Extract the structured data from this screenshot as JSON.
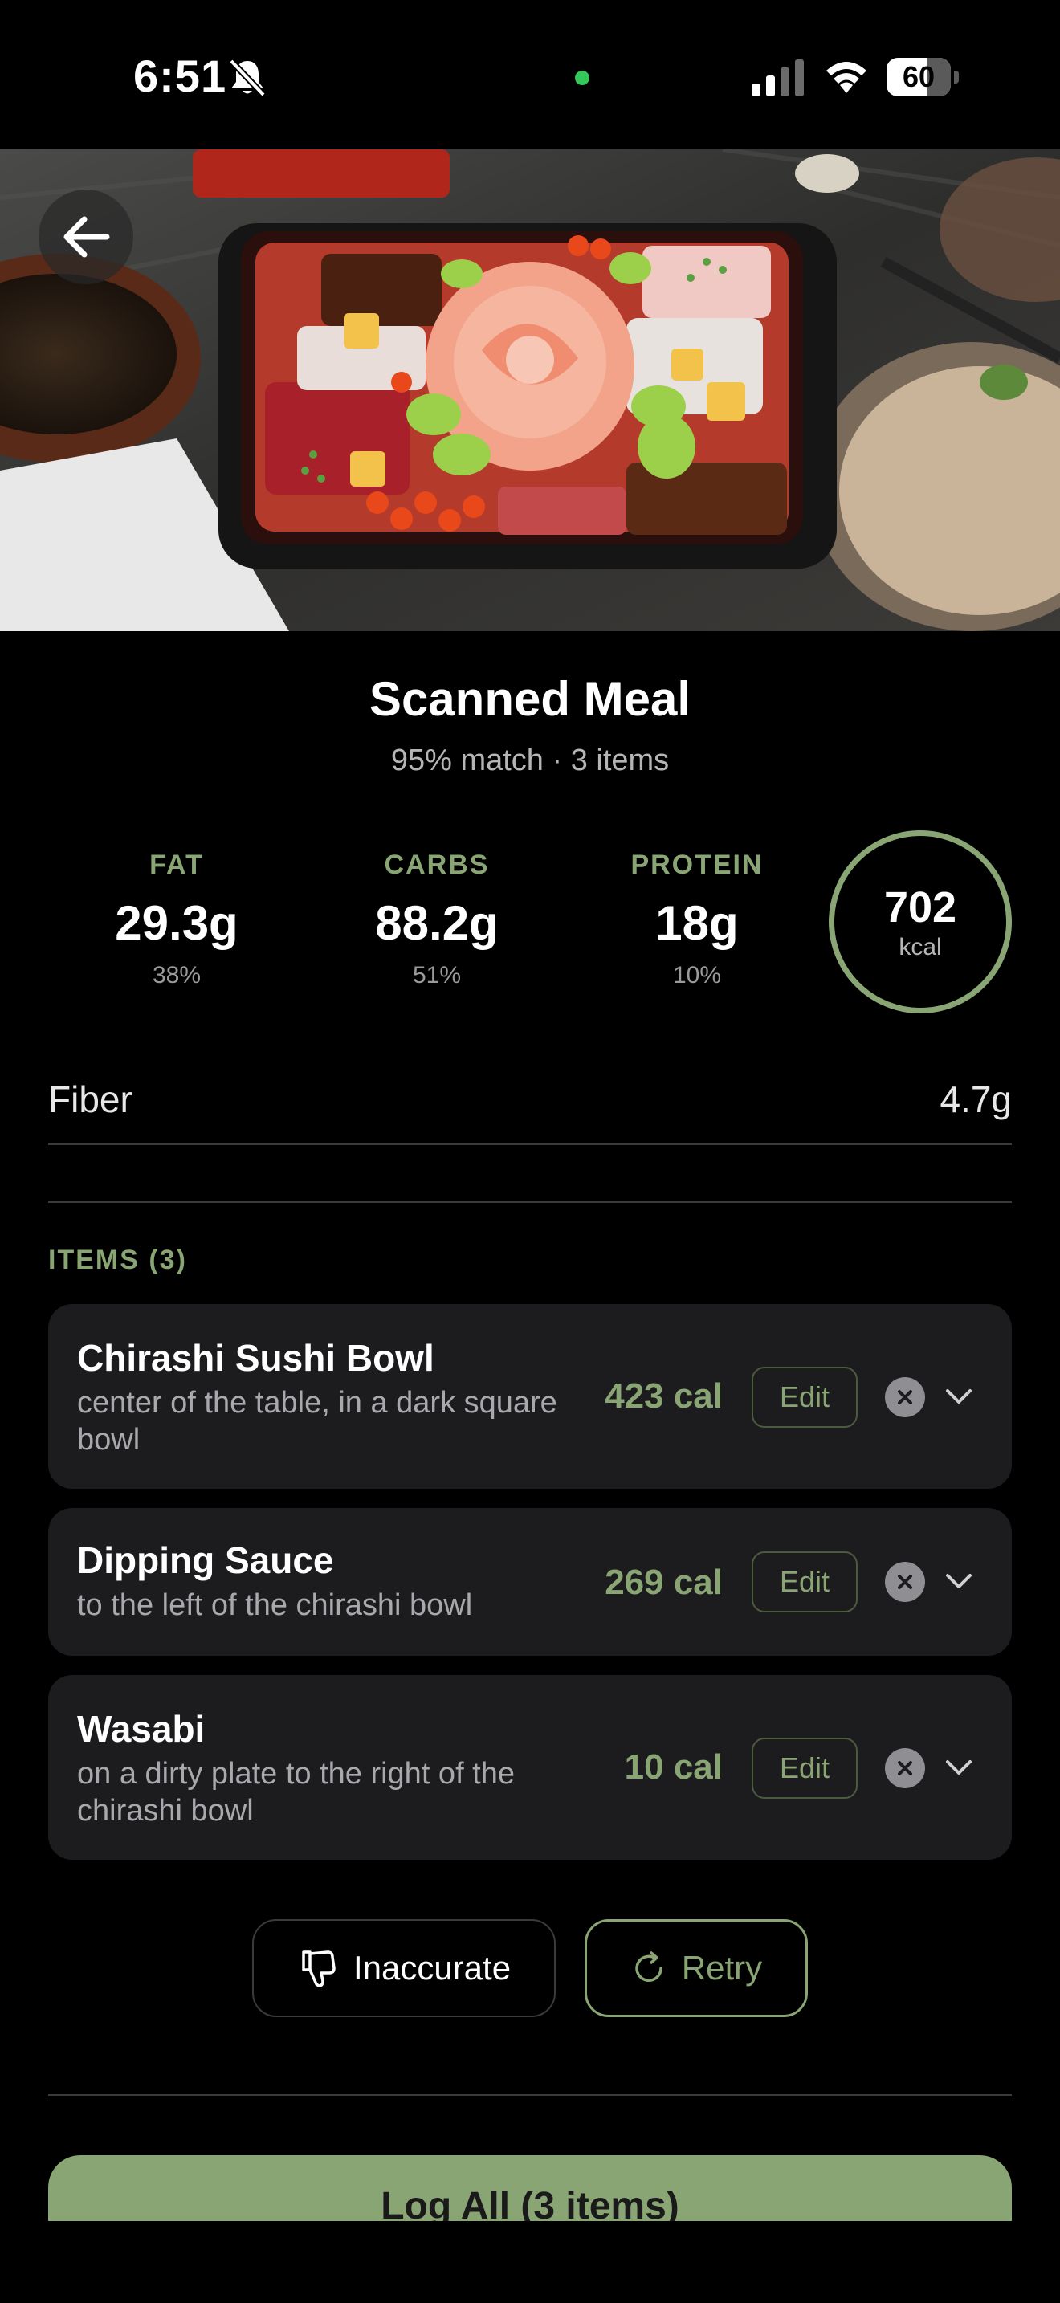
{
  "status_bar": {
    "time": "6:51",
    "battery": "60",
    "icons": [
      "bell-slash-icon",
      "signal-icon",
      "wifi-icon",
      "battery-icon"
    ]
  },
  "hero": {
    "back_icon": "arrow-left-icon"
  },
  "meal": {
    "title": "Scanned Meal",
    "subtitle": "95% match · 3 items"
  },
  "macros": [
    {
      "label": "FAT",
      "value": "29.3g",
      "percent": "38%"
    },
    {
      "label": "CARBS",
      "value": "88.2g",
      "percent": "51%"
    },
    {
      "label": "PROTEIN",
      "value": "18g",
      "percent": "10%"
    }
  ],
  "calories": {
    "value": "702",
    "unit": "kcal"
  },
  "fiber": {
    "label": "Fiber",
    "value": "4.7g"
  },
  "items_header": "ITEMS (3)",
  "items": [
    {
      "name": "Chirashi Sushi Bowl",
      "description": "center of the table, in a dark square bowl",
      "calories": "423 cal",
      "edit_label": "Edit"
    },
    {
      "name": "Dipping Sauce",
      "description": "to the left of the chirashi bowl",
      "calories": "269 cal",
      "edit_label": "Edit"
    },
    {
      "name": "Wasabi",
      "description": "on a dirty plate to the right of the chirashi bowl",
      "calories": "10 cal",
      "edit_label": "Edit"
    }
  ],
  "actions": {
    "inaccurate_label": "Inaccurate",
    "retry_label": "Retry",
    "log_all_label": "Log All (3 items)"
  },
  "colors": {
    "accent": "#8aa574",
    "background": "#000000",
    "card": "#1c1c1e"
  }
}
